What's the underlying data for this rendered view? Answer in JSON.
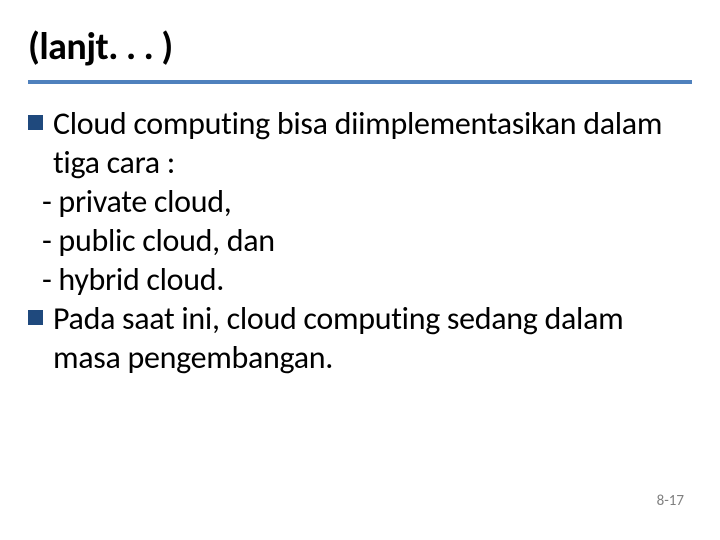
{
  "title": "(lanjt. . . )",
  "bullets": [
    {
      "main": "Cloud computing bisa diimplementasikan dalam tiga cara :",
      "subs": [
        "- private cloud,",
        "- public cloud, dan",
        "- hybrid cloud."
      ]
    },
    {
      "main": "Pada saat ini, cloud computing sedang dalam masa pengembangan.",
      "subs": []
    }
  ],
  "page_number": "8-17"
}
